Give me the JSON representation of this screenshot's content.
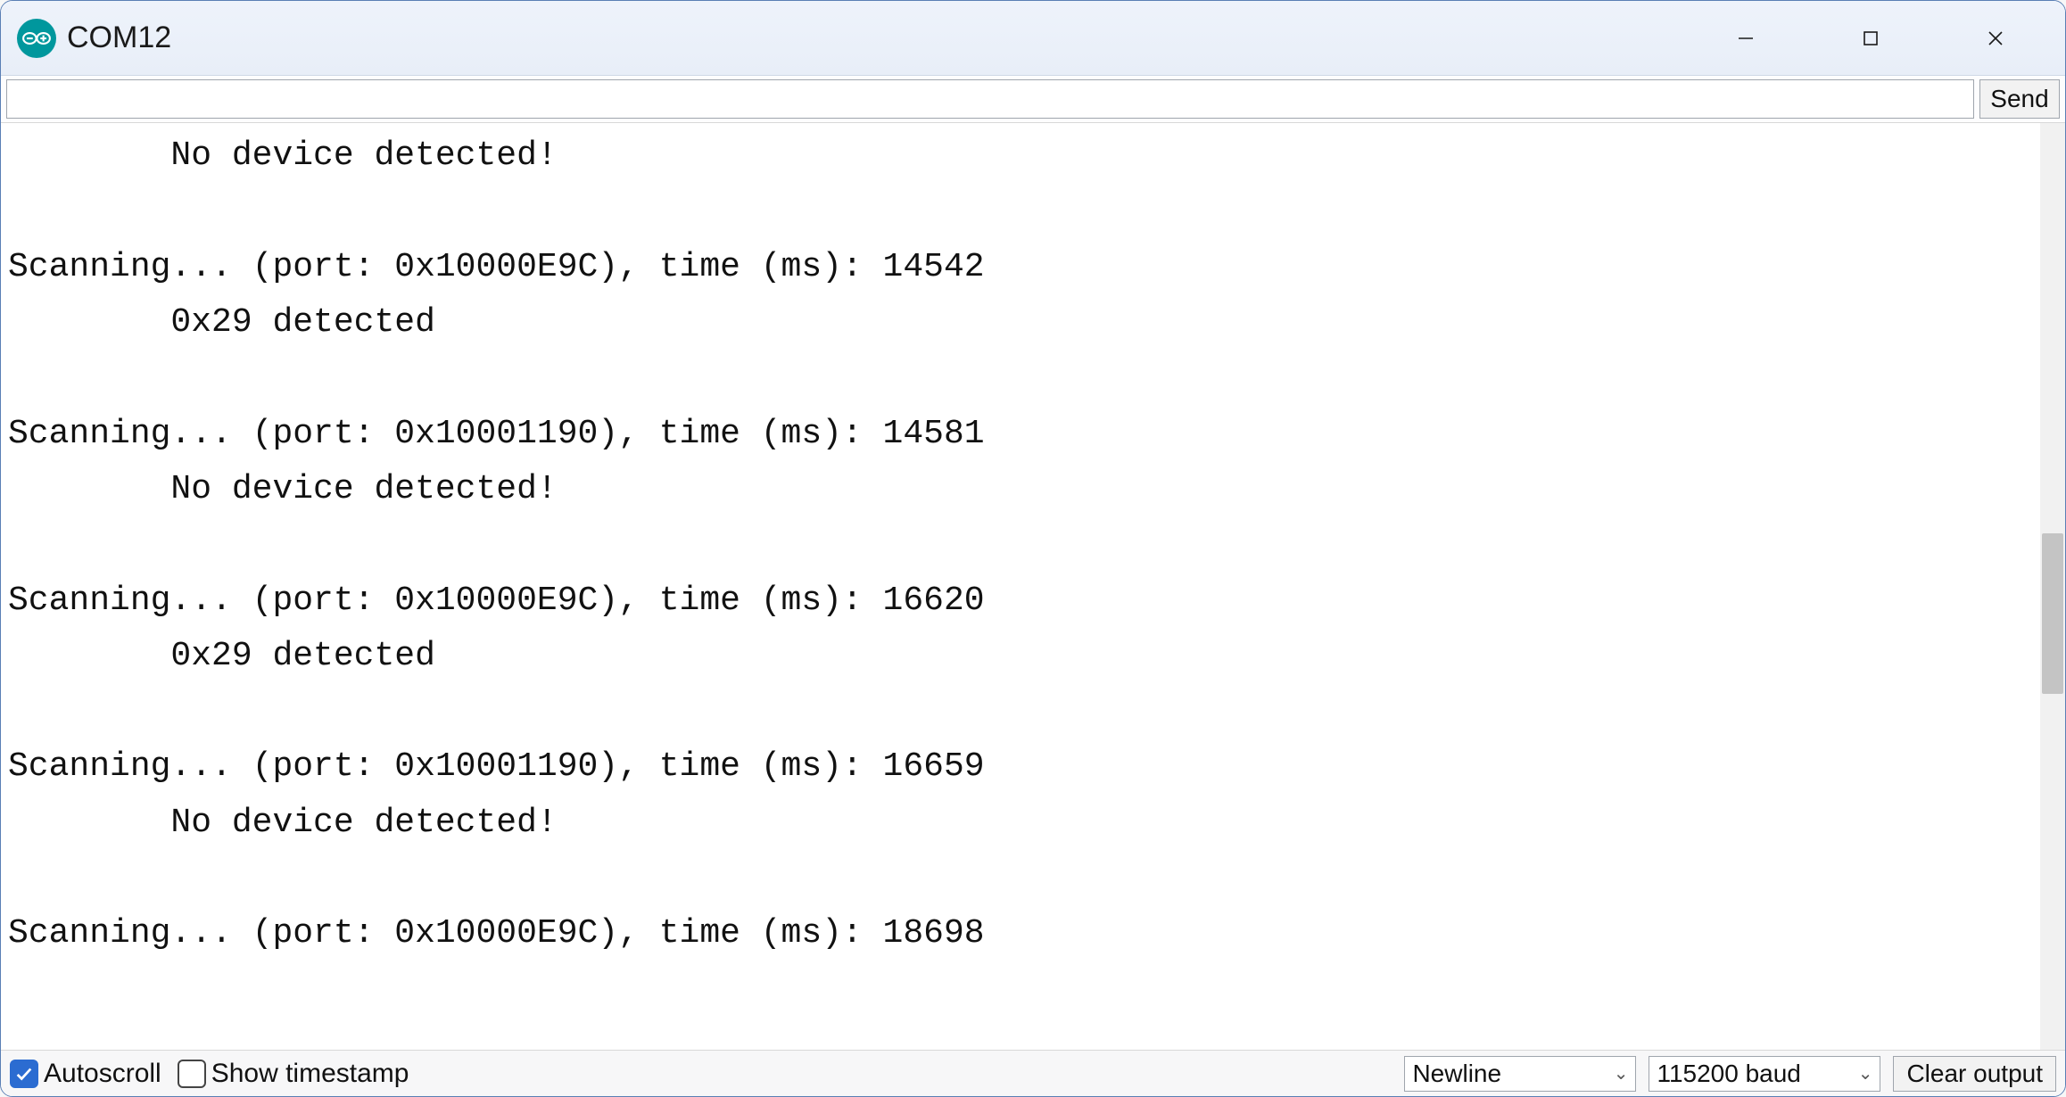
{
  "window": {
    "title": "COM12"
  },
  "toolbar": {
    "send_label": "Send",
    "input_value": ""
  },
  "console": {
    "lines": [
      "        No device detected!",
      "",
      "Scanning... (port: 0x10000E9C), time (ms): 14542",
      "        0x29 detected",
      "",
      "Scanning... (port: 0x10001190), time (ms): 14581",
      "        No device detected!",
      "",
      "Scanning... (port: 0x10000E9C), time (ms): 16620",
      "        0x29 detected",
      "",
      "Scanning... (port: 0x10001190), time (ms): 16659",
      "        No device detected!",
      "",
      "Scanning... (port: 0x10000E9C), time (ms): 18698",
      ""
    ]
  },
  "statusbar": {
    "autoscroll_label": "Autoscroll",
    "autoscroll_checked": true,
    "show_timestamp_label": "Show timestamp",
    "show_timestamp_checked": false,
    "line_ending": "Newline",
    "baud_rate": "115200 baud",
    "clear_label": "Clear output"
  }
}
